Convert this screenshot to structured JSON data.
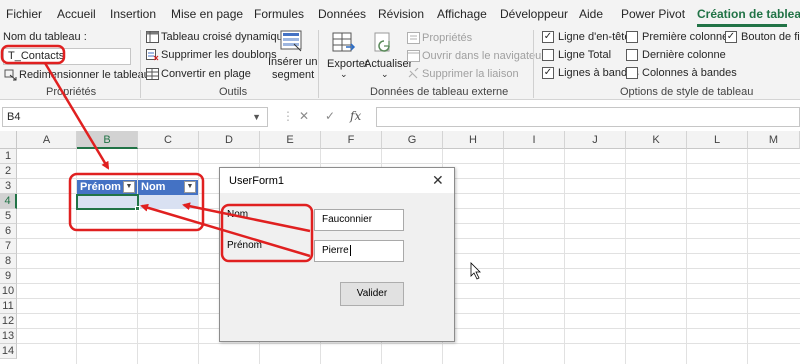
{
  "ribbon_tabs": [
    "Fichier",
    "Accueil",
    "Insertion",
    "Mise en page",
    "Formules",
    "Données",
    "Révision",
    "Affichage",
    "Développeur",
    "Aide",
    "Power Pivot",
    "Création de tableau"
  ],
  "ribbon": {
    "proprietes": {
      "table_name_label": "Nom du tableau :",
      "table_name_value": "T_Contacts",
      "resize_label": "Redimensionner le tableau",
      "group_label": "Propriétés"
    },
    "outils": {
      "pivot_label": "Tableau croisé dynamique",
      "remove_duplicates_label": "Supprimer les doublons",
      "convert_label": "Convertir en plage",
      "insert_slicer_line1": "Insérer un",
      "insert_slicer_line2": "segment",
      "group_label": "Outils"
    },
    "external": {
      "export_label": "Exporter",
      "refresh_label": "Actualiser",
      "properties_label": "Propriétés",
      "open_browser_label": "Ouvrir dans le navigateur",
      "unlink_label": "Supprimer la liaison",
      "group_label": "Données de tableau externe"
    },
    "style_options": {
      "header_row": {
        "label": "Ligne d'en-tête",
        "checked": true
      },
      "total_row": {
        "label": "Ligne Total",
        "checked": false
      },
      "banded_rows": {
        "label": "Lignes à bandes",
        "checked": true
      },
      "first_column": {
        "label": "Première colonne",
        "checked": false
      },
      "last_column": {
        "label": "Dernière colonne",
        "checked": false
      },
      "banded_columns": {
        "label": "Colonnes à bandes",
        "checked": false
      },
      "filter_button": {
        "label": "Bouton de filtre",
        "checked": true
      },
      "group_label": "Options de style de tableau"
    }
  },
  "formula_bar": {
    "name_box": "B4",
    "cancel_symbol": "✕",
    "enter_symbol": "✓",
    "fx_symbol": "fx",
    "formula": ""
  },
  "grid": {
    "columns": [
      "A",
      "B",
      "C",
      "D",
      "E",
      "F",
      "G",
      "H",
      "I",
      "J",
      "K",
      "L",
      "M"
    ],
    "rows": [
      "1",
      "2",
      "3",
      "4",
      "5",
      "6",
      "7",
      "8",
      "9",
      "10",
      "11",
      "12",
      "13",
      "14"
    ],
    "selected_column": "B",
    "selected_row": "4",
    "table_headers": [
      "Prénom",
      "Nom"
    ]
  },
  "userform": {
    "title": "UserForm1",
    "close_symbol": "✕",
    "nom_label": "Nom",
    "nom_value": "Fauconnier",
    "prenom_label": "Prénom",
    "prenom_value": "Pierre",
    "submit_label": "Valider"
  },
  "colors": {
    "excel_green": "#217346",
    "table_header": "#4472c4",
    "table_band": "#d9e1f2",
    "annotation_red": "#e02020"
  }
}
